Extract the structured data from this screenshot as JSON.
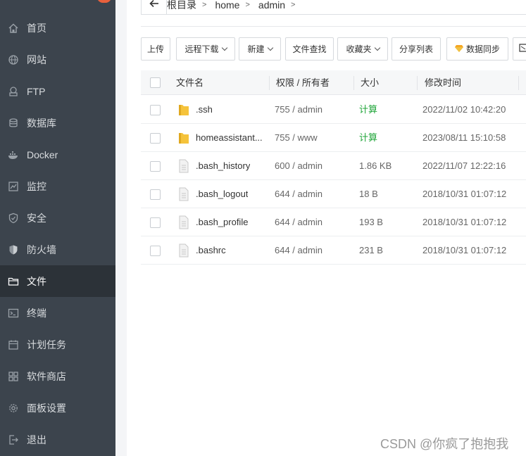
{
  "sidebar": {
    "items": [
      {
        "label": "首页",
        "icon": "home-icon"
      },
      {
        "label": "网站",
        "icon": "globe-icon"
      },
      {
        "label": "FTP",
        "icon": "ftp-icon"
      },
      {
        "label": "数据库",
        "icon": "database-icon"
      },
      {
        "label": "Docker",
        "icon": "docker-icon"
      },
      {
        "label": "监控",
        "icon": "monitor-icon"
      },
      {
        "label": "安全",
        "icon": "shield-check-icon"
      },
      {
        "label": "防火墙",
        "icon": "firewall-shield-icon"
      },
      {
        "label": "文件",
        "icon": "folder-icon",
        "active": true
      },
      {
        "label": "终端",
        "icon": "terminal-icon"
      },
      {
        "label": "计划任务",
        "icon": "calendar-icon"
      },
      {
        "label": "软件商店",
        "icon": "apps-grid-icon"
      },
      {
        "label": "面板设置",
        "icon": "gear-icon"
      },
      {
        "label": "退出",
        "icon": "logout-icon"
      }
    ]
  },
  "breadcrumb": {
    "back_icon": "arrow-left-icon",
    "items": [
      "根目录",
      "home",
      "admin"
    ]
  },
  "toolbar": {
    "upload": "上传",
    "remote_download": "远程下载",
    "new": "新建",
    "file_search": "文件查找",
    "favorites": "收藏夹",
    "share_list": "分享列表",
    "data_sync": "数据同步"
  },
  "table": {
    "headers": {
      "name": "文件名",
      "perm": "权限 / 所有者",
      "size": "大小",
      "mtime": "修改时间"
    },
    "rows": [
      {
        "type": "folder",
        "name": ".ssh",
        "perm": "755 / admin",
        "size": "计算",
        "mtime": "2022/11/02 10:42:20"
      },
      {
        "type": "folder",
        "name": "homeassistant...",
        "perm": "755 / www",
        "size": "计算",
        "mtime": "2023/08/11 15:10:58"
      },
      {
        "type": "file",
        "name": ".bash_history",
        "perm": "600 / admin",
        "size": "1.86 KB",
        "mtime": "2022/11/07 12:22:16"
      },
      {
        "type": "file",
        "name": ".bash_logout",
        "perm": "644 / admin",
        "size": "18 B",
        "mtime": "2018/10/31 01:07:12"
      },
      {
        "type": "file",
        "name": ".bash_profile",
        "perm": "644 / admin",
        "size": "193 B",
        "mtime": "2018/10/31 01:07:12"
      },
      {
        "type": "file",
        "name": ".bashrc",
        "perm": "644 / admin",
        "size": "231 B",
        "mtime": "2018/10/31 01:07:12"
      }
    ]
  },
  "watermark": "CSDN @你疯了抱抱我",
  "colors": {
    "sidebar_bg": "#3c444d",
    "sidebar_active_bg": "#2c3238",
    "calc_green": "#20a53a",
    "folder_yellow": "#f5c33b",
    "gem_orange": "#f5a623"
  }
}
